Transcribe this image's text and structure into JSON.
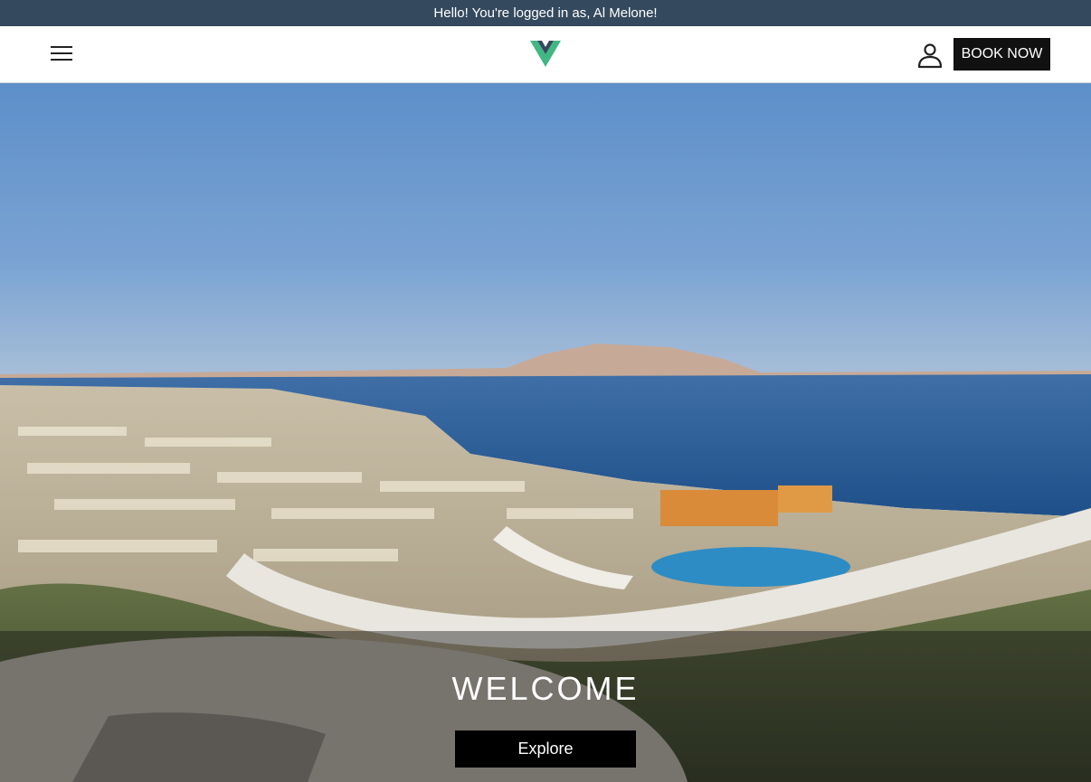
{
  "banner": {
    "text": "Hello! You're logged in as, Al Melone!"
  },
  "header": {
    "menu_icon": "hamburger-menu-icon",
    "logo_icon": "vue-logo-icon",
    "account_icon": "user-account-icon",
    "book_label": "BOOK NOW"
  },
  "hero": {
    "image": "aerial view of seaside resort with sea and island",
    "title": "WELCOME",
    "explore_label": "Explore"
  },
  "colors": {
    "banner_bg": "#34495e",
    "logo_green": "#41b883",
    "logo_dark": "#35495e",
    "button_bg": "#111111"
  }
}
